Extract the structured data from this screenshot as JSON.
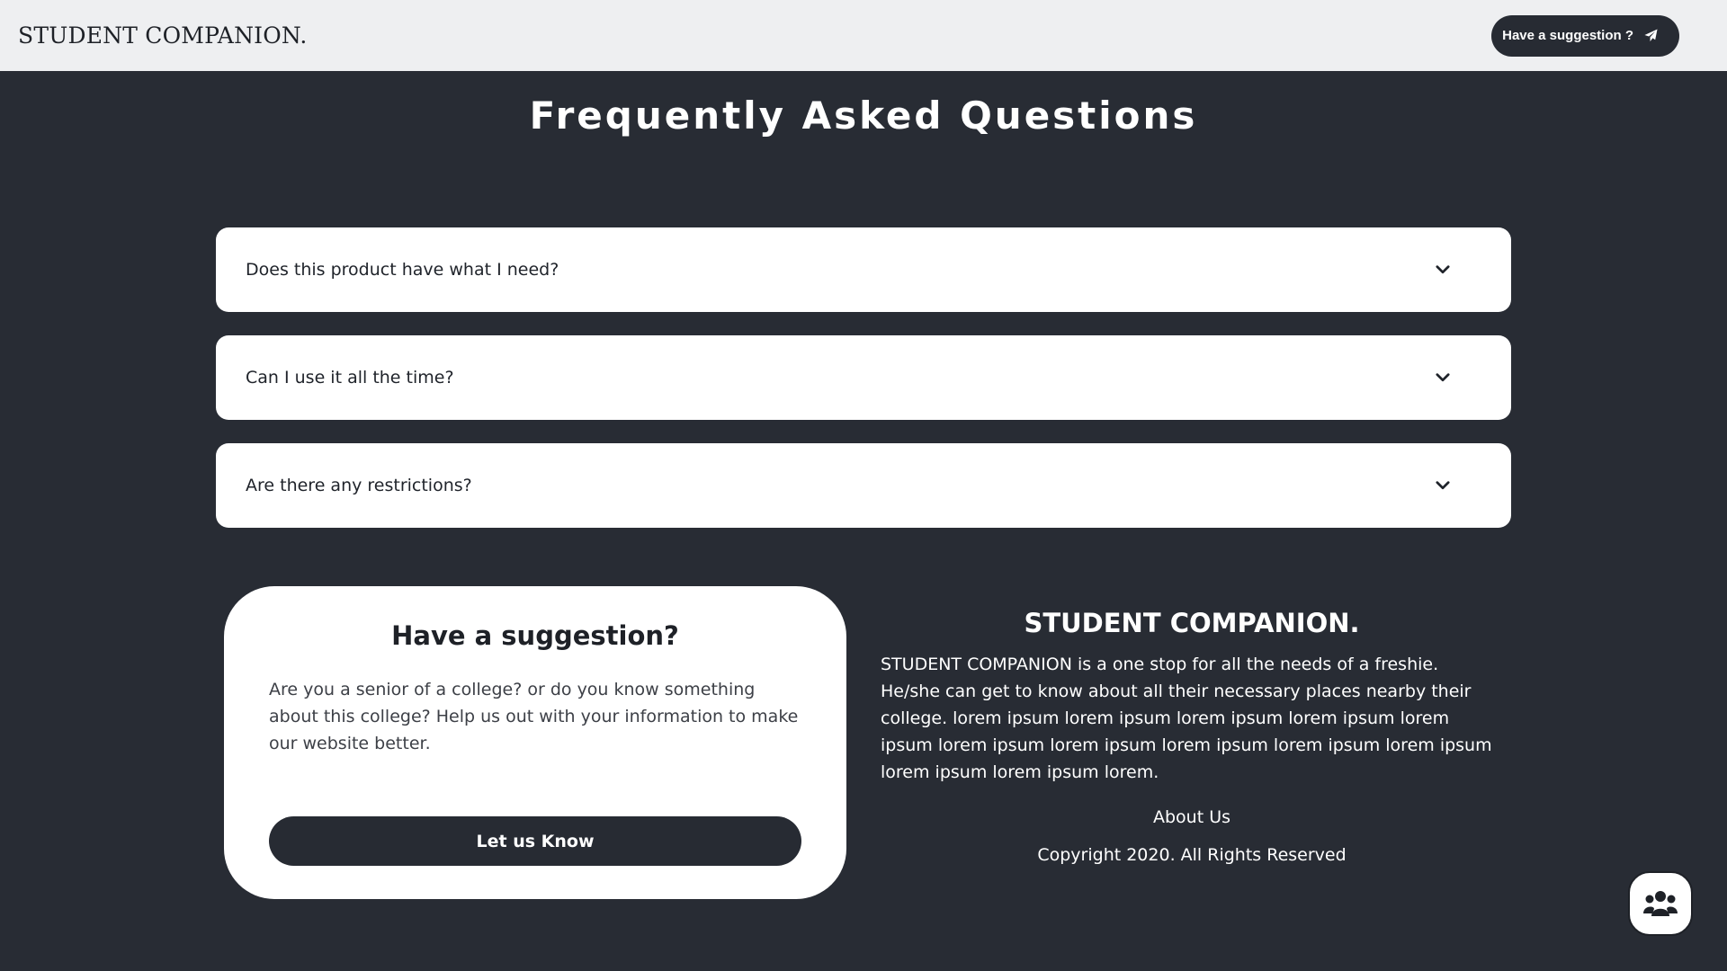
{
  "header": {
    "brand": "STUDENT COMPANION.",
    "suggestion_button": "Have a suggestion ?",
    "suggestion_icon": "paper-plane-icon"
  },
  "faq": {
    "title": "Frequently Asked Questions",
    "items": [
      {
        "question": "Does this product have what I need?",
        "icon": "chevron-down-icon"
      },
      {
        "question": "Can I use it all the time?",
        "icon": "chevron-down-icon"
      },
      {
        "question": "Are there any restrictions?",
        "icon": "chevron-down-icon"
      }
    ]
  },
  "suggestion_card": {
    "title": "Have a suggestion?",
    "text": "Are you a senior of a college? or do you know something about this college? Help us out with your information to make our website better.",
    "button": "Let us Know"
  },
  "footer": {
    "title": "STUDENT COMPANION.",
    "description": "STUDENT COMPANION is a one stop for all the needs of a freshie. He/she can get to know about all their necessary places nearby their college. lorem ipsum lorem ipsum lorem ipsum lorem ipsum lorem ipsum lorem ipsum lorem ipsum lorem ipsum lorem ipsum lorem ipsum lorem ipsum lorem ipsum lorem.",
    "about_link": "About Us",
    "copyright": "Copyright 2020. All Rights Reserved"
  },
  "fab": {
    "icon": "users-icon"
  },
  "colors": {
    "background": "#282c34",
    "header_bg": "#eeeff1",
    "card_bg": "#ffffff",
    "button_dark": "#272b33"
  }
}
